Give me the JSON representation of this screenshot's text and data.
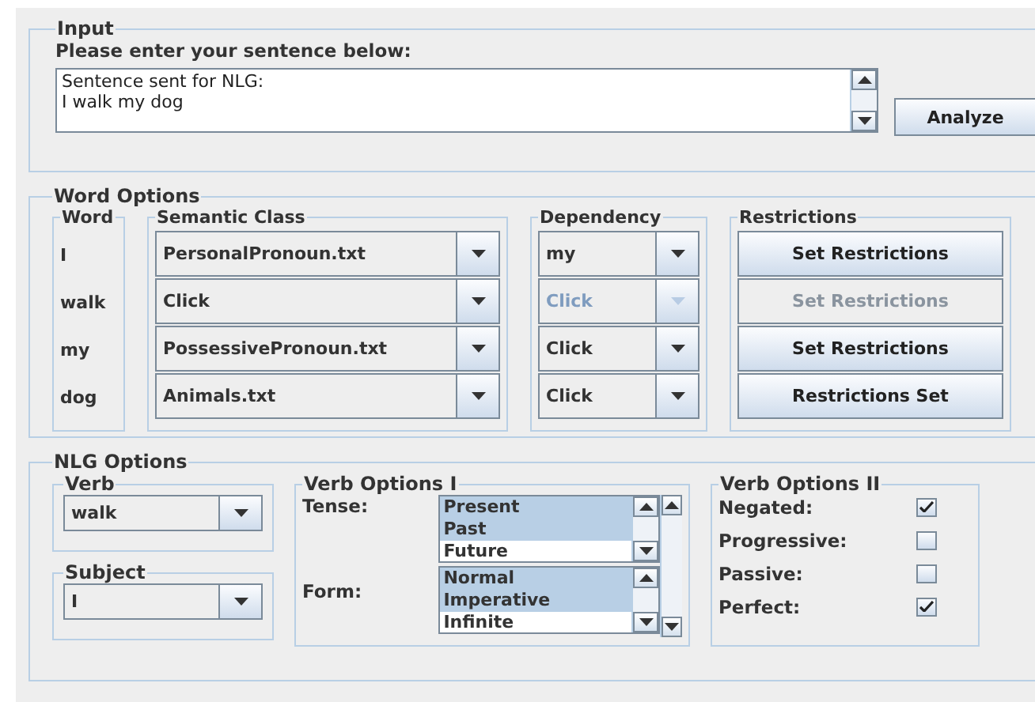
{
  "input": {
    "title": "Input",
    "prompt": "Please enter your sentence below:",
    "lines": [
      "Sentence sent for NLG:",
      "I walk my dog"
    ],
    "analyze_button": "Analyze"
  },
  "word_options": {
    "title": "Word Options",
    "headers": {
      "word": "Word",
      "semantic": "Semantic Class",
      "dependency": "Dependency",
      "restrictions": "Restrictions"
    },
    "rows": [
      {
        "word": "I",
        "semantic": "PersonalPronoun.txt",
        "dependency": "my",
        "dependency_disabled": false,
        "restriction": "Set Restrictions",
        "restriction_disabled": false
      },
      {
        "word": "walk",
        "semantic": "Click",
        "dependency": "Click",
        "dependency_disabled": true,
        "restriction": "Set Restrictions",
        "restriction_disabled": true
      },
      {
        "word": "my",
        "semantic": "PossessivePronoun.txt",
        "dependency": "Click",
        "dependency_disabled": false,
        "restriction": "Set Restrictions",
        "restriction_disabled": false
      },
      {
        "word": "dog",
        "semantic": "Animals.txt",
        "dependency": "Click",
        "dependency_disabled": false,
        "restriction": "Restrictions Set",
        "restriction_disabled": false
      }
    ]
  },
  "nlg_options": {
    "title": "NLG Options",
    "verb": {
      "title": "Verb",
      "value": "walk"
    },
    "subject": {
      "title": "Subject",
      "value": "I"
    },
    "verb_options_1": {
      "title": "Verb Options I",
      "tense": {
        "label": "Tense:",
        "items": [
          {
            "label": "Present",
            "selected": true
          },
          {
            "label": "Past",
            "selected": true
          },
          {
            "label": "Future",
            "selected": false
          }
        ]
      },
      "form": {
        "label": "Form:",
        "items": [
          {
            "label": "Normal",
            "selected": true
          },
          {
            "label": "Imperative",
            "selected": true
          },
          {
            "label": "Infinite",
            "selected": false
          }
        ]
      }
    },
    "verb_options_2": {
      "title": "Verb Options II",
      "options": [
        {
          "label": "Negated:",
          "checked": true
        },
        {
          "label": "Progressive:",
          "checked": false
        },
        {
          "label": "Passive:",
          "checked": false
        },
        {
          "label": "Perfect:",
          "checked": true
        }
      ]
    }
  }
}
